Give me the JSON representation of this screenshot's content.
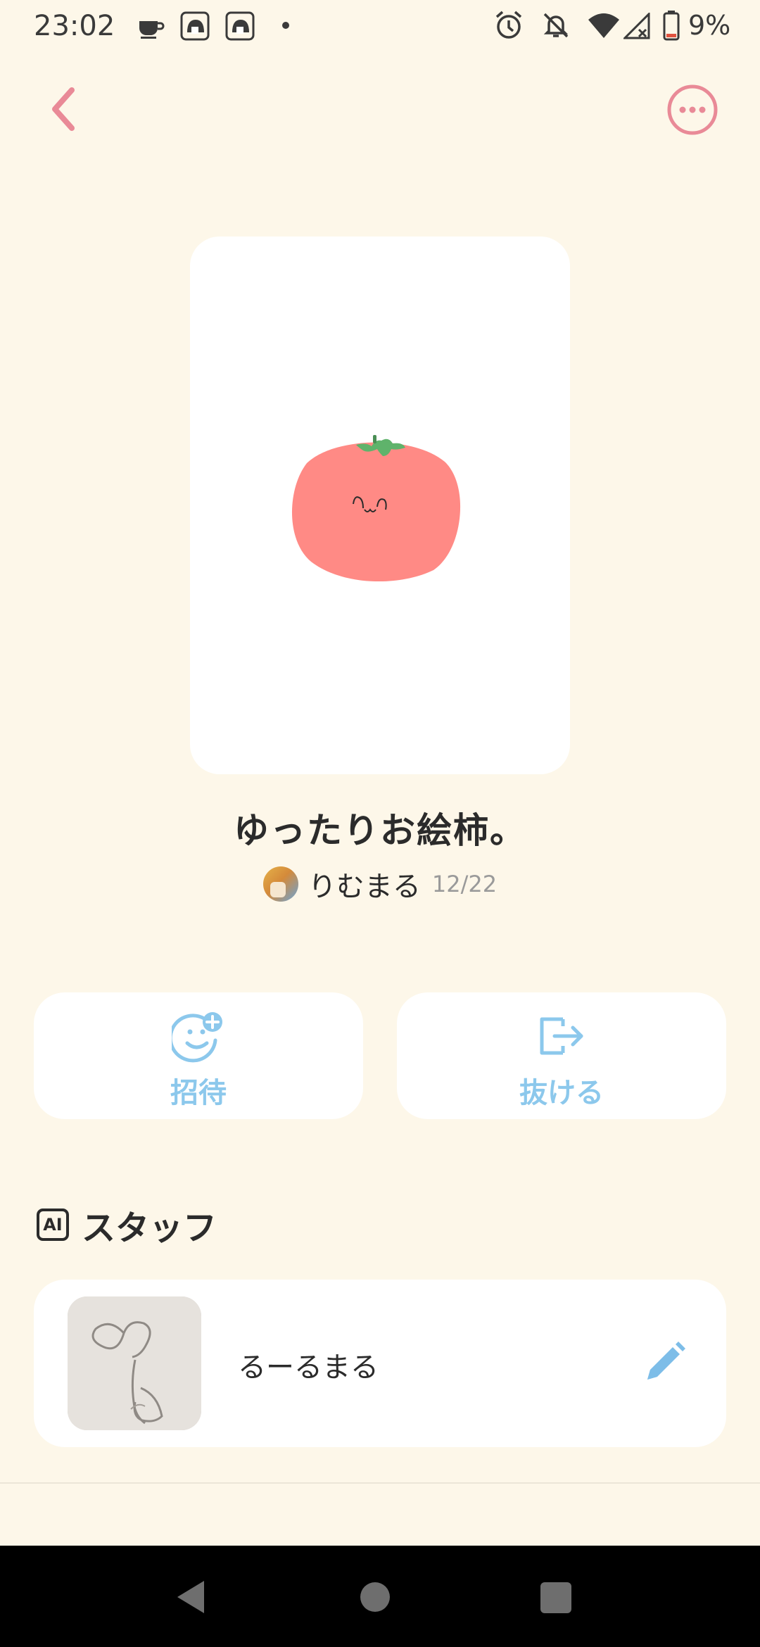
{
  "status_bar": {
    "time": "23:02",
    "battery": "9%",
    "icons": [
      "coffee-icon",
      "avatar-notification-icon",
      "avatar-notification-icon",
      "dot-icon",
      "alarm-icon",
      "mute-icon",
      "wifi-icon",
      "no-signal-icon",
      "battery-icon"
    ]
  },
  "header": {
    "back_icon": "chevron-left-icon",
    "more_icon": "more-horizontal-icon"
  },
  "group": {
    "title": "ゆったりお絵柿。",
    "owner_name": "りむまる",
    "date": "12/22"
  },
  "actions": {
    "invite_label": "招待",
    "leave_label": "抜ける"
  },
  "staff_section": {
    "badge": "AI",
    "title": "スタッフ",
    "staff": [
      {
        "name": "るーるまる"
      }
    ]
  },
  "colors": {
    "background": "#FDF7E9",
    "accent_pink": "#E98A97",
    "accent_blue": "#8CC8EC",
    "persimmon": "#FF8A85",
    "leaf": "#5FB36B"
  }
}
